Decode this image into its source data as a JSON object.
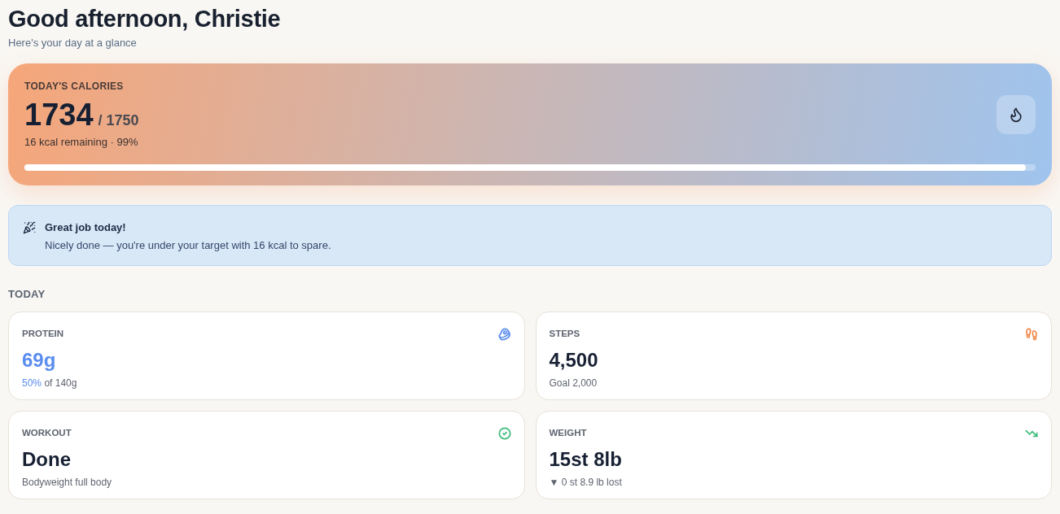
{
  "header": {
    "title": "Good afternoon, Christie",
    "subtitle": "Here's your day at a glance"
  },
  "calories": {
    "label": "TODAY'S CALORIES",
    "value": "1734",
    "target": "/ 1750",
    "summary": "16 kcal remaining · 99%",
    "level": 0.99
  },
  "banner": {
    "title": "Great job today!",
    "message": "Nicely done — you're under your target with 16 kcal to spare."
  },
  "section": {
    "title": "TODAY"
  },
  "cards": [
    {
      "kind": "protein",
      "label": "PROTEIN",
      "value": "69g",
      "value_accent": true,
      "highlight": "50%",
      "sub": "of 140g",
      "color": "#5b8def"
    },
    {
      "kind": "steps",
      "label": "STEPS",
      "value": "4,500",
      "value_accent": false,
      "sub": "Goal 2,000",
      "color": "#f08a4b"
    },
    {
      "kind": "workout",
      "label": "WORKOUT",
      "value": "Done",
      "value_accent": false,
      "sub": "Bodyweight full body",
      "color": "#3dbb7c"
    },
    {
      "kind": "weight",
      "label": "WEIGHT",
      "value": "15st 8lb",
      "value_accent": false,
      "sub": "▼ 0 st 8.9 lb lost",
      "color": "#3dbb7c"
    }
  ]
}
